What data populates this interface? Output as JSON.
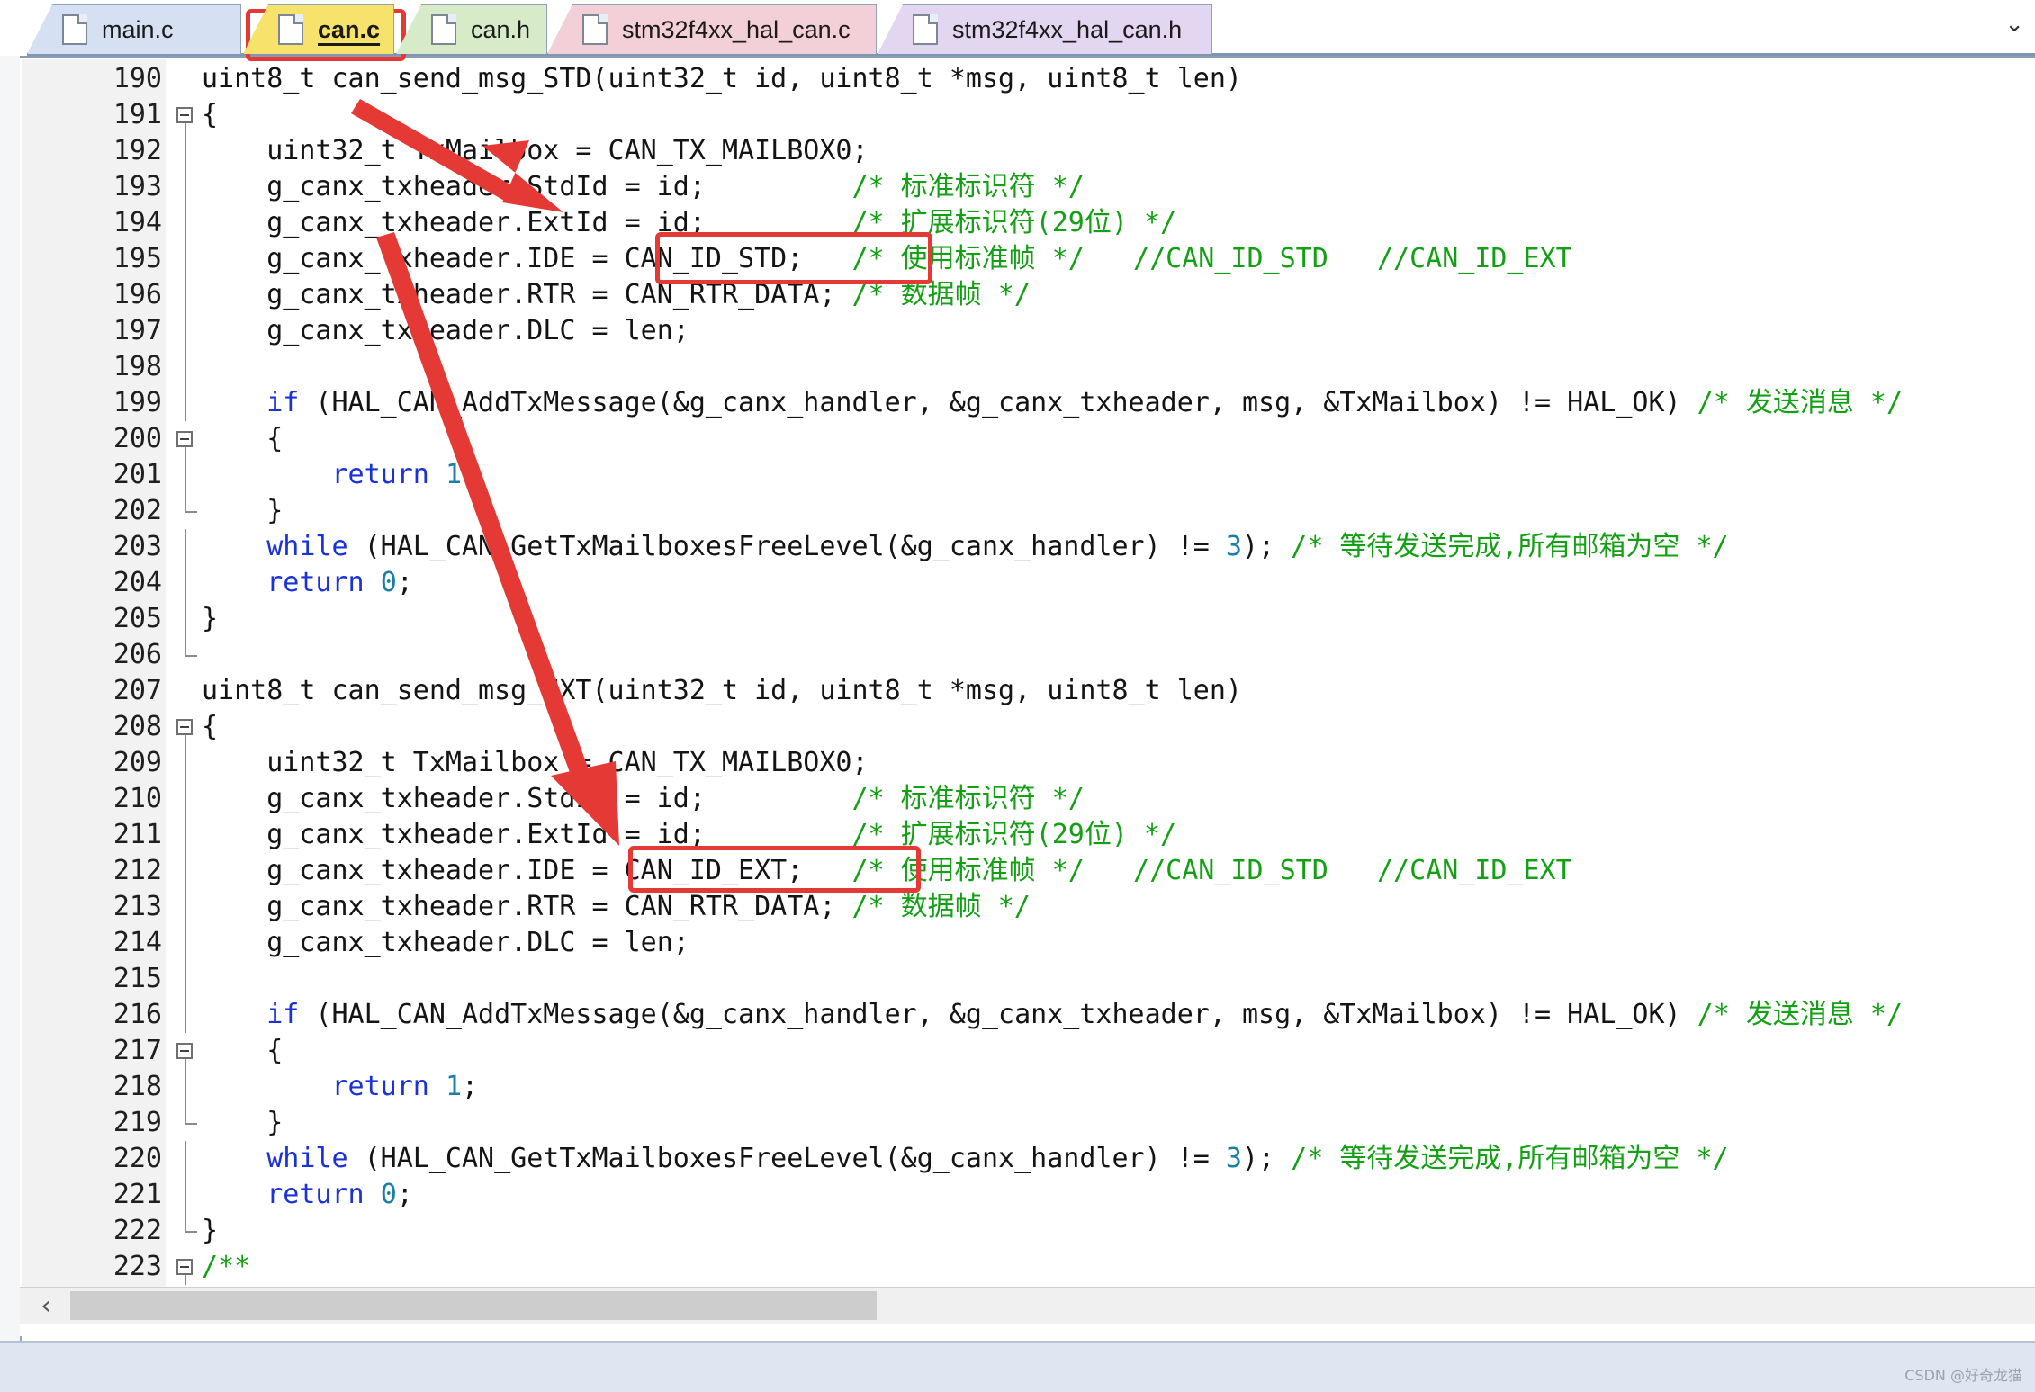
{
  "tabs": [
    {
      "label": "main.c",
      "active": false,
      "color": "#d5e1f2"
    },
    {
      "label": "can.c",
      "active": true,
      "color": "#f7e26b"
    },
    {
      "label": "can.h",
      "active": false,
      "color": "#d7ebc8"
    },
    {
      "label": "stm32f4xx_hal_can.c",
      "active": false,
      "color": "#f3cfd7"
    },
    {
      "label": "stm32f4xx_hal_can.h",
      "active": false,
      "color": "#e2d6f0"
    }
  ],
  "tab_overflow_icon": "chevron-down-icon",
  "lines": [
    {
      "n": "190",
      "fold": "",
      "parts": [
        [
          "t",
          "uint8_t can_send_msg_STD(uint32_t id, uint8_t *msg, uint8_t len)"
        ]
      ]
    },
    {
      "n": "191",
      "fold": "open",
      "parts": [
        [
          "t",
          "{"
        ]
      ]
    },
    {
      "n": "192",
      "fold": "line",
      "parts": [
        [
          "t",
          "    uint32_t TxMailbox = CAN_TX_MAILBOX0;"
        ]
      ]
    },
    {
      "n": "193",
      "fold": "line",
      "parts": [
        [
          "t",
          "    g_canx_txheader.StdId = id;         "
        ],
        [
          "c",
          "/* 标准标识符 */"
        ]
      ]
    },
    {
      "n": "194",
      "fold": "line",
      "parts": [
        [
          "t",
          "    g_canx_txheader.ExtId = id;         "
        ],
        [
          "c",
          "/* 扩展标识符(29位) */"
        ]
      ]
    },
    {
      "n": "195",
      "fold": "line",
      "parts": [
        [
          "t",
          "    g_canx_txheader.IDE = CAN_ID_STD;   "
        ],
        [
          "c",
          "/* 使用标准帧 */   //CAN_ID_STD   //CAN_ID_EXT"
        ]
      ]
    },
    {
      "n": "196",
      "fold": "line",
      "parts": [
        [
          "t",
          "    g_canx_txheader.RTR = CAN_RTR_DATA; "
        ],
        [
          "c",
          "/* 数据帧 */"
        ]
      ]
    },
    {
      "n": "197",
      "fold": "line",
      "parts": [
        [
          "t",
          "    g_canx_txheader.DLC = len;"
        ]
      ]
    },
    {
      "n": "198",
      "fold": "line",
      "parts": []
    },
    {
      "n": "199",
      "fold": "line",
      "parts": [
        [
          "t",
          "    "
        ],
        [
          "k",
          "if"
        ],
        [
          "t",
          " (HAL_CAN_AddTxMessage(&g_canx_handler, &g_canx_txheader, msg, &TxMailbox) != HAL_OK) "
        ],
        [
          "c",
          "/* 发送消息 */"
        ]
      ]
    },
    {
      "n": "200",
      "fold": "open",
      "parts": [
        [
          "t",
          "    {"
        ]
      ]
    },
    {
      "n": "201",
      "fold": "line",
      "parts": [
        [
          "t",
          "        "
        ],
        [
          "k",
          "return"
        ],
        [
          "t",
          " "
        ],
        [
          "n",
          "1"
        ],
        [
          "t",
          ";"
        ]
      ]
    },
    {
      "n": "202",
      "fold": "end",
      "parts": [
        [
          "t",
          "    }"
        ]
      ]
    },
    {
      "n": "203",
      "fold": "line",
      "parts": [
        [
          "t",
          "    "
        ],
        [
          "k",
          "while"
        ],
        [
          "t",
          " (HAL_CAN_GetTxMailboxesFreeLevel(&g_canx_handler) != "
        ],
        [
          "n",
          "3"
        ],
        [
          "t",
          "); "
        ],
        [
          "c",
          "/* 等待发送完成,所有邮箱为空 */"
        ]
      ]
    },
    {
      "n": "204",
      "fold": "line",
      "parts": [
        [
          "t",
          "    "
        ],
        [
          "k",
          "return"
        ],
        [
          "t",
          " "
        ],
        [
          "n",
          "0"
        ],
        [
          "t",
          ";"
        ]
      ]
    },
    {
      "n": "205",
      "fold": "line",
      "parts": [
        [
          "t",
          "}"
        ]
      ]
    },
    {
      "n": "206",
      "fold": "end",
      "parts": []
    },
    {
      "n": "207",
      "fold": "",
      "parts": [
        [
          "t",
          "uint8_t can_send_msg_EXT(uint32_t id, uint8_t *msg, uint8_t len)"
        ]
      ]
    },
    {
      "n": "208",
      "fold": "open",
      "parts": [
        [
          "t",
          "{"
        ]
      ]
    },
    {
      "n": "209",
      "fold": "line",
      "parts": [
        [
          "t",
          "    uint32_t TxMailbox = CAN_TX_MAILBOX0;"
        ]
      ]
    },
    {
      "n": "210",
      "fold": "line",
      "parts": [
        [
          "t",
          "    g_canx_txheader.StdId = id;         "
        ],
        [
          "c",
          "/* 标准标识符 */"
        ]
      ]
    },
    {
      "n": "211",
      "fold": "line",
      "parts": [
        [
          "t",
          "    g_canx_txheader.ExtId = id;         "
        ],
        [
          "c",
          "/* 扩展标识符(29位) */"
        ]
      ]
    },
    {
      "n": "212",
      "fold": "line",
      "parts": [
        [
          "t",
          "    g_canx_txheader.IDE = CAN_ID_EXT;   "
        ],
        [
          "c",
          "/* 使用标准帧 */   //CAN_ID_STD   //CAN_ID_EXT"
        ]
      ]
    },
    {
      "n": "213",
      "fold": "line",
      "parts": [
        [
          "t",
          "    g_canx_txheader.RTR = CAN_RTR_DATA; "
        ],
        [
          "c",
          "/* 数据帧 */"
        ]
      ]
    },
    {
      "n": "214",
      "fold": "line",
      "parts": [
        [
          "t",
          "    g_canx_txheader.DLC = len;"
        ]
      ]
    },
    {
      "n": "215",
      "fold": "line",
      "parts": []
    },
    {
      "n": "216",
      "fold": "line",
      "parts": [
        [
          "t",
          "    "
        ],
        [
          "k",
          "if"
        ],
        [
          "t",
          " (HAL_CAN_AddTxMessage(&g_canx_handler, &g_canx_txheader, msg, &TxMailbox) != HAL_OK) "
        ],
        [
          "c",
          "/* 发送消息 */"
        ]
      ]
    },
    {
      "n": "217",
      "fold": "open",
      "parts": [
        [
          "t",
          "    {"
        ]
      ]
    },
    {
      "n": "218",
      "fold": "line",
      "parts": [
        [
          "t",
          "        "
        ],
        [
          "k",
          "return"
        ],
        [
          "t",
          " "
        ],
        [
          "n",
          "1"
        ],
        [
          "t",
          ";"
        ]
      ]
    },
    {
      "n": "219",
      "fold": "end",
      "parts": [
        [
          "t",
          "    }"
        ]
      ]
    },
    {
      "n": "220",
      "fold": "line",
      "parts": [
        [
          "t",
          "    "
        ],
        [
          "k",
          "while"
        ],
        [
          "t",
          " (HAL_CAN_GetTxMailboxesFreeLevel(&g_canx_handler) != "
        ],
        [
          "n",
          "3"
        ],
        [
          "t",
          "); "
        ],
        [
          "c",
          "/* 等待发送完成,所有邮箱为空 */"
        ]
      ]
    },
    {
      "n": "221",
      "fold": "line",
      "parts": [
        [
          "t",
          "    "
        ],
        [
          "k",
          "return"
        ],
        [
          "t",
          " "
        ],
        [
          "n",
          "0"
        ],
        [
          "t",
          ";"
        ]
      ]
    },
    {
      "n": "222",
      "fold": "end",
      "parts": [
        [
          "t",
          "}"
        ]
      ]
    },
    {
      "n": "223",
      "fold": "open",
      "parts": [
        [
          "c",
          "/**"
        ]
      ]
    }
  ],
  "colors": {
    "keyword": "#1a32d8",
    "number": "#1a7fa8",
    "comment": "#14a014",
    "highlight": "#e53935"
  },
  "watermark": "CSDN @好奇龙猫"
}
